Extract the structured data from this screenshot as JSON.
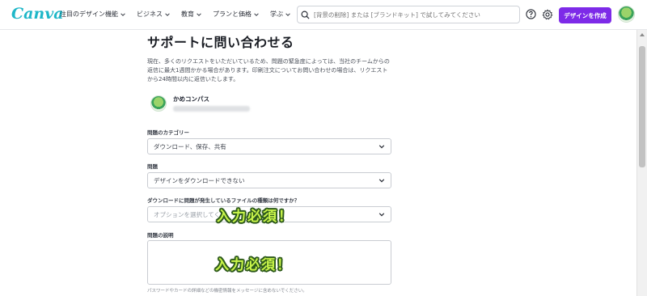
{
  "header": {
    "logo": "Canva",
    "nav": [
      {
        "label": "注目のデザイン機能"
      },
      {
        "label": "ビジネス"
      },
      {
        "label": "教育"
      },
      {
        "label": "プランと価格"
      },
      {
        "label": "学ぶ"
      }
    ],
    "search_placeholder": "[背景の削除] または [ブランドキット] で試してみてください",
    "create_button": "デザインを作成"
  },
  "page": {
    "title": "サポートに問い合わせる",
    "intro": "現在、多くのリクエストをいただいているため、問題の緊急度によっては、当社のチームからの返信に最大1週間かかる場合があります。印刷注文についてお問い合わせの場合は、リクエストから24時間以内に返信いたします。",
    "user_name": "かめコンパス"
  },
  "form": {
    "category_label": "問題のカテゴリー",
    "category_value": "ダウンロード、保存、共有",
    "issue_label": "問題",
    "issue_value": "デザインをダウンロードできない",
    "filetype_label": "ダウンロードに問題が発生しているファイルの種類は何ですか？",
    "filetype_placeholder": "オプションを選択してく",
    "description_label": "問題の説明",
    "hint": "パスワードやカードの詳細などの機密情報をメッセージに含めないでください。"
  },
  "annotations": {
    "required_1": "入力必須！",
    "required_2": "入力必須！"
  },
  "colors": {
    "brand": "#1fb7c8",
    "create_button": "#7d2ae8",
    "annotation_fill": "#c9f54a",
    "annotation_outline": "#2e5a1c"
  }
}
